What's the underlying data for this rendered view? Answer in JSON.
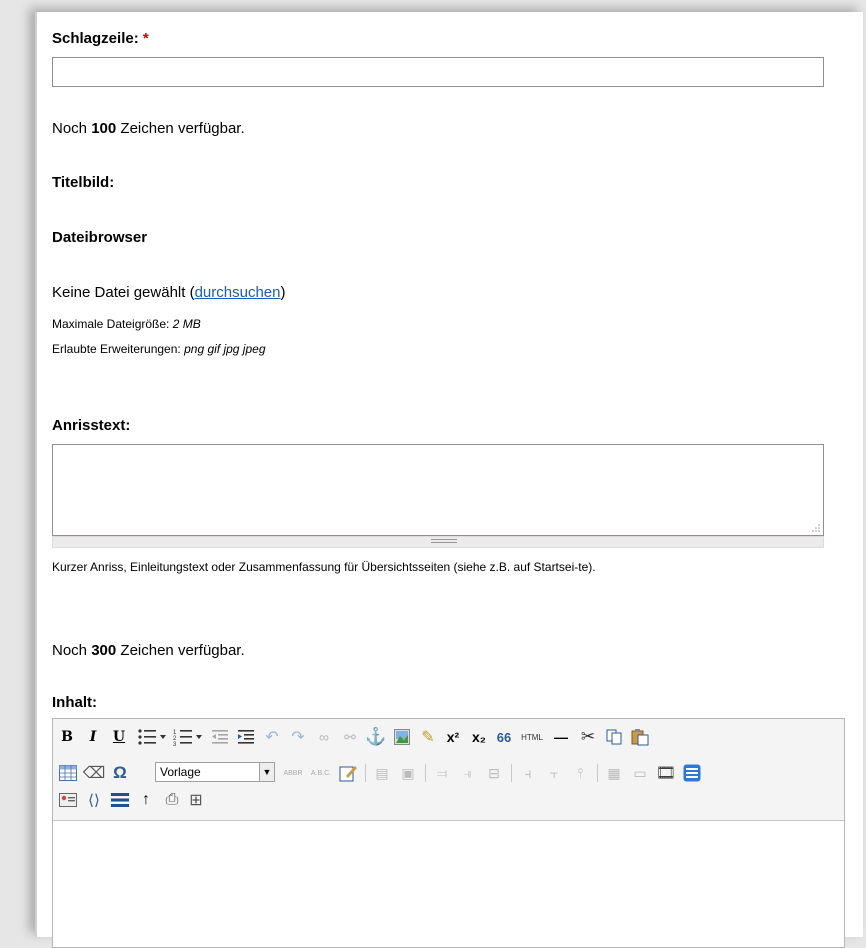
{
  "headline": {
    "label": "Schlagzeile:",
    "required_mark": "*",
    "value": "",
    "remaining_prefix": "Noch",
    "remaining_count": "100",
    "remaining_suffix": "Zeichen verfügbar."
  },
  "title_image": {
    "label": "Titelbild:",
    "browser_heading": "Dateibrowser",
    "no_file_prefix": "Keine Datei gewählt (",
    "browse_link": "durchsuchen",
    "no_file_suffix": ")",
    "max_size_label": "Maximale Dateigröße:",
    "max_size_value": "2 MB",
    "extensions_label": "Erlaubte Erweiterungen:",
    "extensions_value": "png gif jpg jpeg"
  },
  "teaser": {
    "label": "Anrisstext:",
    "value": "",
    "help_text": "Kurzer Anriss, Einleitungstext oder Zusammenfassung für Übersichtsseiten (siehe z.B. auf Startsei-te).",
    "remaining_prefix": "Noch",
    "remaining_count": "300",
    "remaining_suffix": "Zeichen verfügbar."
  },
  "content": {
    "label": "Inhalt:",
    "style_select": "Vorlage",
    "toolbar_text": {
      "bold": "B",
      "italic": "I",
      "underline": "U",
      "superscript": "x²",
      "subscript": "x₂",
      "quote": "66",
      "html": "HTML",
      "hr": "—",
      "omega": "Ω",
      "abbr": "ABBR",
      "abc": "A.B.C."
    }
  }
}
